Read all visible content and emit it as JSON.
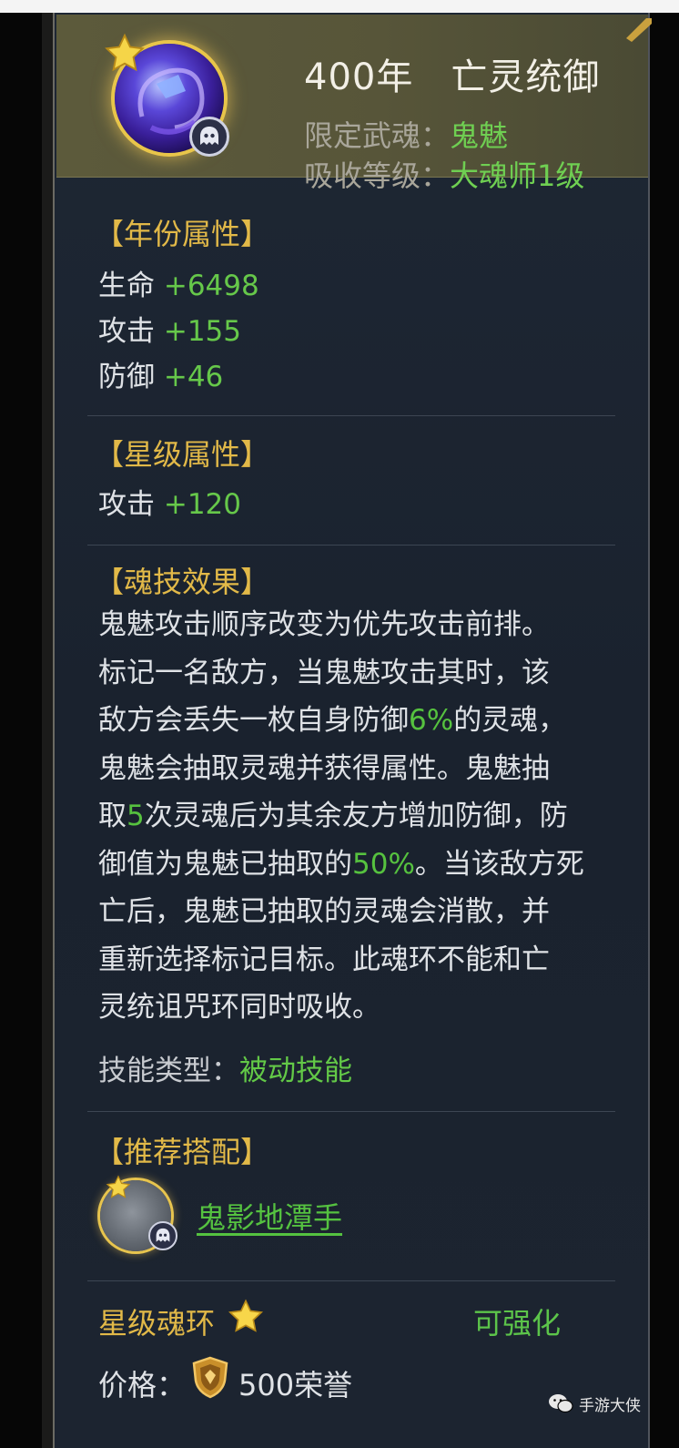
{
  "header": {
    "title": "400年　亡灵统御",
    "restrict_label": "限定武魂：",
    "restrict_value": "鬼魅",
    "absorb_label": "吸收等级：",
    "absorb_value": "大魂师1级"
  },
  "year_attrs": {
    "title": "【年份属性】",
    "items": [
      {
        "label": "生命 ",
        "value": "+6498"
      },
      {
        "label": "攻击 ",
        "value": "+155"
      },
      {
        "label": "防御 ",
        "value": "+46"
      }
    ]
  },
  "star_attrs": {
    "title": "【星级属性】",
    "items": [
      {
        "label": "攻击 ",
        "value": "+120"
      }
    ]
  },
  "skill": {
    "title": "【魂技效果】",
    "lines": [
      [
        "鬼魅攻击顺序改变为优先攻击前排。"
      ],
      [
        "标记一名敌方，当鬼魅攻击其时，该"
      ],
      [
        "敌方会丢失一枚自身防御",
        "6%",
        "的灵魂，"
      ],
      [
        "鬼魅会抽取灵魂并获得属性。鬼魅抽"
      ],
      [
        "取",
        "5",
        "次灵魂后为其余友方增加防御，防"
      ],
      [
        "御值为鬼魅已抽取的",
        "50%",
        "。当该敌方死"
      ],
      [
        "亡后，鬼魅已抽取的灵魂会消散，并"
      ],
      [
        "重新选择标记目标。此魂环不能和亡"
      ],
      [
        "灵统诅咒环同时吸收。"
      ]
    ],
    "type_label": "技能类型：",
    "type_value": "被动技能"
  },
  "recommend": {
    "title": "【推荐搭配】",
    "link": "鬼影地潭手"
  },
  "footer": {
    "star_ring_label": "星级魂环",
    "upgrade_label": "可强化",
    "price_label": "价格：",
    "price_value": "500荣誉"
  },
  "watermark": {
    "text": "手游大侠"
  },
  "colors": {
    "gold": "#e2b948",
    "green": "#63c947",
    "text": "#dfe2e6"
  }
}
